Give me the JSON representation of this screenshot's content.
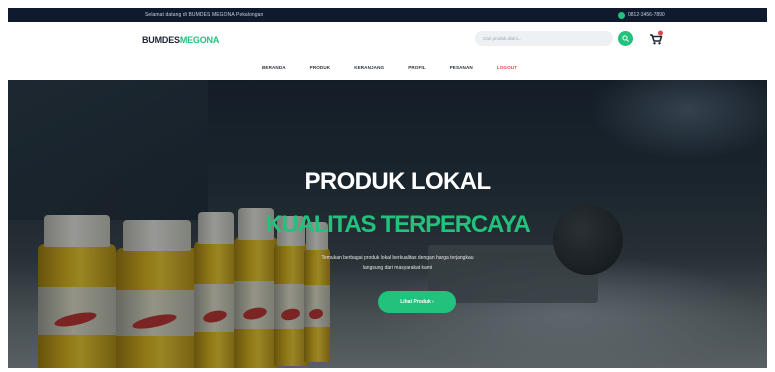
{
  "topbar": {
    "welcome_text": "Selamat datang di BUMDES MEGONA Pekalongan",
    "contact_icon": "phone-icon",
    "contact_text": "0812-3456-7890"
  },
  "header": {
    "logo_primary": "BUMDES",
    "logo_accent": "MEGONA",
    "search_placeholder": "Cari produk disini...",
    "search_icon": "search-icon",
    "cart_icon": "cart-icon"
  },
  "nav": {
    "items": [
      {
        "label": "BERANDA"
      },
      {
        "label": "PRODUK"
      },
      {
        "label": "KERANJANG"
      },
      {
        "label": "PROFIL"
      },
      {
        "label": "PESANAN"
      },
      {
        "label": "LOGOUT"
      }
    ]
  },
  "hero": {
    "title": "PRODUK LOKAL",
    "subtitle": "KUALITAS TERPERCAYA",
    "description_line1": "Temukan berbagai produk lokal berkualitas dengan harga terjangkau",
    "description_line2": "langsung dari masyarakat kami",
    "button_label": "Lihat Produk ›"
  },
  "colors": {
    "topbar_bg": "#0f1a2e",
    "accent_green": "#22c17c",
    "logout_red": "#e8454f",
    "text_dark": "#1e2633"
  }
}
